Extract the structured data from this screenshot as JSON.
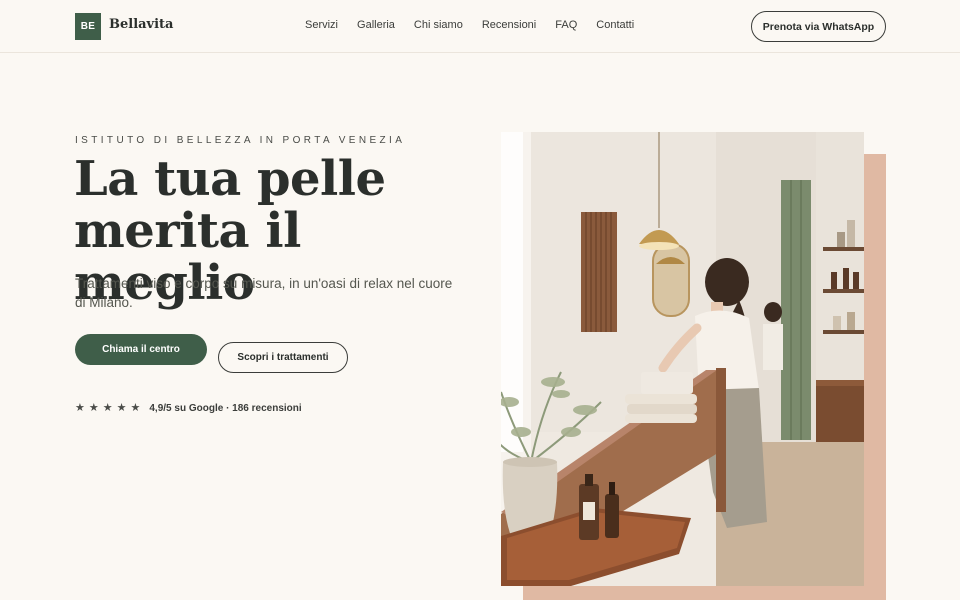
{
  "header": {
    "logo_initials": "BE",
    "brand_name": "Bellavita",
    "nav": [
      "Servizi",
      "Galleria",
      "Chi siamo",
      "Recensioni",
      "FAQ",
      "Contatti"
    ],
    "cta_label": "Prenota via WhatsApp"
  },
  "hero": {
    "eyebrow": "ISTITUTO DI BELLEZZA IN PORTA VENEZIA",
    "headline_line1": "La tua pelle",
    "headline_line2": "merita il meglio",
    "subtitle": "Trattamenti viso e corpo su misura, in un'oasi di relax nel cuore di Milano.",
    "primary_button": "Chiama il centro",
    "secondary_button": "Scopri i trattamenti",
    "rating_stars": 5,
    "rating_text": "4,9/5 su Google · 186 recensioni"
  },
  "colors": {
    "accent_green": "#3f5e49",
    "background": "#fbf8f3",
    "image_backdrop": "#e0b9a3"
  }
}
